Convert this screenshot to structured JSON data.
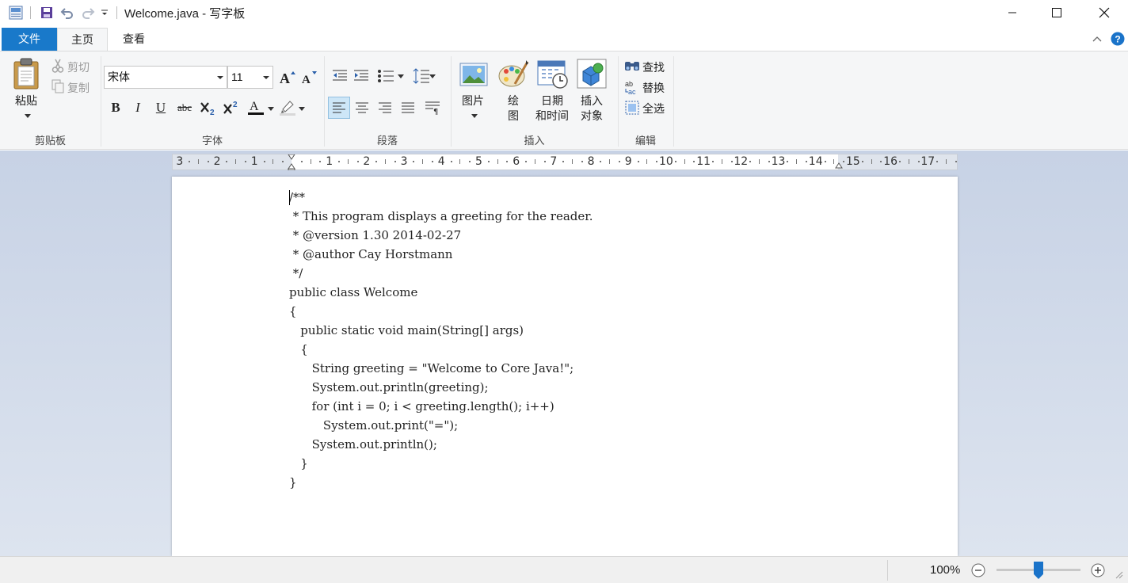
{
  "window": {
    "title": "Welcome.java - 写字板",
    "controls": {
      "minimize": "minimize-icon",
      "maximize": "maximize-icon",
      "close": "close-icon"
    }
  },
  "quick_access": [
    "app-icon",
    "save-icon",
    "undo-icon",
    "redo-icon",
    "customize-icon"
  ],
  "tabs": [
    {
      "label": "文件",
      "selected": false
    },
    {
      "label": "主页",
      "selected": true
    },
    {
      "label": "查看",
      "selected": false
    }
  ],
  "ribbon": {
    "clipboard": {
      "label": "剪贴板",
      "paste": "粘贴",
      "cut": "剪切",
      "copy": "复制"
    },
    "font": {
      "label": "字体",
      "family": "宋体",
      "size": "11"
    },
    "paragraph": {
      "label": "段落"
    },
    "insert": {
      "label": "插入",
      "picture": "图片",
      "paint_line1": "绘",
      "paint_line2": "图",
      "datetime_line1": "日期",
      "datetime_line2": "和时间",
      "object_line1": "插入",
      "object_line2": "对象"
    },
    "edit": {
      "label": "编辑",
      "find": "查找",
      "replace": "替换",
      "select_all": "全选"
    }
  },
  "ruler": {
    "numbers": [
      "3",
      "2",
      "1",
      "1",
      "2",
      "3",
      "4",
      "5",
      "6",
      "7",
      "8",
      "9",
      "10",
      "11",
      "12",
      "13",
      "14",
      "15",
      "16",
      "17"
    ]
  },
  "document": {
    "lines": [
      "/**",
      " * This program displays a greeting for the reader.",
      " * @version 1.30 2014-02-27",
      " * @author Cay Horstmann",
      " */",
      "public class Welcome",
      "{",
      "   public static void main(String[] args)",
      "   {",
      "      String greeting = \"Welcome to Core Java!\";",
      "      System.out.println(greeting);",
      "      for (int i = 0; i < greeting.length(); i++)",
      "         System.out.print(\"=\");",
      "      System.out.println();",
      "   }",
      "}"
    ]
  },
  "status": {
    "zoom": "100%",
    "zoom_fraction": 0.5
  },
  "colors": {
    "file_tab": "#1979ca",
    "ribbon_bg": "#f5f6f7",
    "workspace": "#c7d2e5",
    "accent": "#1a73c9"
  }
}
